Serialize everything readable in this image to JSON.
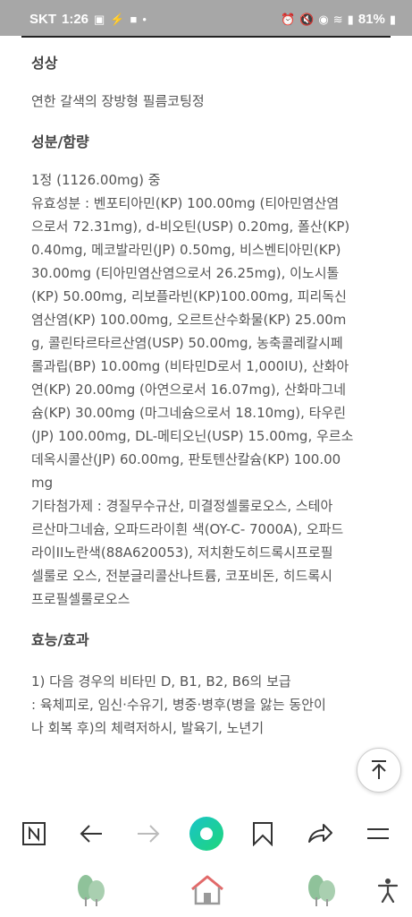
{
  "status": {
    "carrier": "SKT",
    "time": "1:26",
    "battery": "81%"
  },
  "sections": [
    {
      "heading": "성상",
      "lines": [
        "연한 갈색의 장방형 필름코팅정"
      ]
    },
    {
      "heading": "성분/함량",
      "lines": [
        "1정 (1126.00mg) 중",
        "유효성분 : 벤포티아민(KP) 100.00mg (티아민염산염",
        "으로서 72.31mg), d-비오틴(USP) 0.20mg, 폴산(KP)",
        "0.40mg, 메코발라민(JP) 0.50mg, 비스벤티아민(KP)",
        "30.00mg (티아민염산염으로서 26.25mg), 이노시톨",
        "(KP) 50.00mg, 리보플라빈(KP)100.00mg, 피리독신",
        "염산염(KP) 100.00mg, 오르트산수화물(KP) 25.00m",
        "g, 콜린타르타르산염(USP) 50.00mg, 농축콜레칼시페",
        "롤과립(BP) 10.00mg (비타민D로서 1,000IU), 산화아",
        "연(KP) 20.00mg (아연으로서 16.07mg), 산화마그네",
        "슘(KP) 30.00mg (마그네슘으로서 18.10mg), 타우린",
        "(JP) 100.00mg, DL-메티오닌(USP) 15.00mg, 우르소",
        "데옥시콜산(JP) 60.00mg, 판토텐산칼슘(KP) 100.00",
        "mg",
        "기타첨가제 : 경질무수규산, 미결정셀룰로오스, 스테아",
        "르산마그네슘, 오파드라이흰 색(OY-C- 7000A), 오파드",
        "라이II노란색(88A620053), 저치환도히드록시프로필",
        "셀룰로 오스, 전분글리콜산나트륨, 코포비돈, 히드록시",
        "프로필셀룰로오스"
      ]
    },
    {
      "heading": "효능/효과",
      "lines": [
        "1) 다음 경우의 비타민 D, B1, B2, B6의 보급",
        ": 육체피로, 임신·수유기, 병중·병후(병을 앓는 동안이",
        "나 회복 후)의 체력저하시, 발육기, 노년기"
      ]
    }
  ],
  "toolbar": {
    "icons": [
      "naver-n-icon",
      "back-arrow-icon",
      "forward-arrow-icon",
      "green-circle-icon",
      "bookmark-icon",
      "share-icon",
      "menu-icon"
    ]
  },
  "navbar": {
    "icons": [
      "tree-icon",
      "home-icon",
      "tree-icon",
      "accessibility-icon"
    ]
  },
  "colors": {
    "statusbar": "#a7a7a7",
    "accent_green": "#1fd6a0",
    "accent_teal": "#19c4c8",
    "roof_red": "#e26a6a",
    "tree_green": "#8fc29a"
  }
}
